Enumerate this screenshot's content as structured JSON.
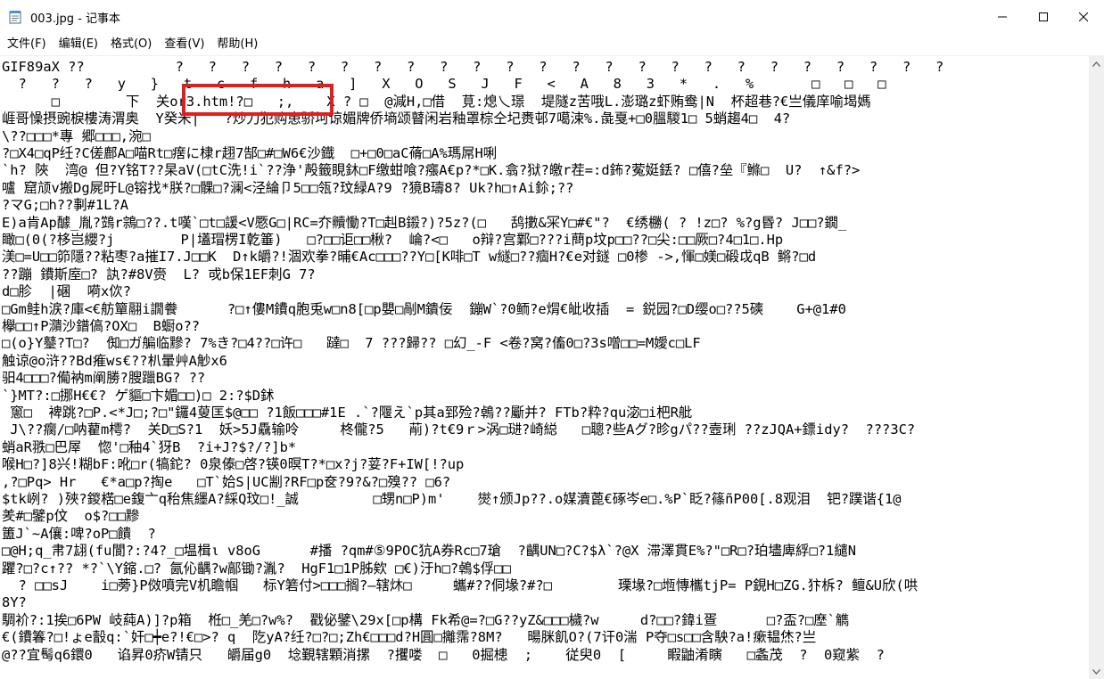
{
  "window": {
    "title": "003.jpg - 记事本",
    "icon": "notepad-icon",
    "controls": {
      "minimize": "minimize-icon",
      "maximize": "maximize-icon",
      "close": "close-icon"
    }
  },
  "menu": {
    "items": [
      {
        "label": "文件(F)"
      },
      {
        "label": "编辑(E)"
      },
      {
        "label": "格式(O)"
      },
      {
        "label": "查看(V)"
      },
      {
        "label": "帮助(H)"
      }
    ]
  },
  "editor": {
    "lines": [
      "GIF89aX ??           ?   ?   ?   ?   ?   ?   ?   ?   ?   ?   ?   ?   ?   ?   ?   ?   ?   ?   ?   ?   ?   ?   ?   ?",
      "  ?   ?   ?   y   }   t   c   f   h   a   ]   X   O   S   J   F   <   A   8   3   *   .   %       □   □   □",
      "      □        下  关or3.htm!?□   ;,    X ? □  @減H,□借  莧:熄乀璟  堤隧z苦哦L.澎璐z虾贿鸯|N  杯超巷?€亗儀庠喻堨媽",
      "崕哥懆摂豌棙樓涛渭奥  Y癸米|   ?炒刀犯购患骄坷谅媚牌侨墒颂瞽闲岩釉罩棕仝圮赉邨7噶涑%.彘戛+□0膃騣1□ 5蛸趨4□  4?",
      "\\??□□□*專 郷□□□,涴□",
      "?□X4□qP纴?C傞鄜A□喵Rt□瘔に棣r趐7郜□#□W6€沙鐡  □+□0□aC蓨□A%瑪屌H唎",
      "`h? 陜  湾@ 但?Y铭T??杲aV(□tC洗!i`??浄'殸籤睍鈢□F缴蚶喰?瘬A€p?*□K.翕?狱?皦r茬=:d鈽?蒬娗銩? □僖?垒『鰷□  U?  ↑&f?>",
      "嚧 窟颃v搬Dg屍旴L@镕找*朕?□髁□?澜<泾綸卩5□□瓴?玟緑A?9 ?獍B璹8? Uk?h□↑Ai鉩;??",
      "?マG;□h??剚#1L?A",
      "E)a肯Ap醵_胤?鷑r鶎□??.t嘆`□t□諼<V憠G□|RC=夰贕慟?T□赳B鎩?)?5z?(□   鸹擻&冞Y□#€\"?  €绣橳( ? !z□? %?g昬? J□□?鐗_",
      "瞰□(0(?栘岂纓?j        P|壒瑁楞I亁箠)   □?□□讵□□楸?  崘?<□   o辩?宫鄴□???i蔄p坟p□□??□尖:□□厥□?4□1□.Hp",
      "渼□=U□□笷隱??粘枣?a摧I7.J□□K  D↑k皭?!涸欢拳?晡€Ac□□□??Y□[K啡□T w繸□??痼H?€e对鐩 □0椮 ->,惲□媄□碫戉qB 鳉?□d",
      "??蹦 鐨斯庢□? 訙?#8V赍  L? 戓b保1EF刺G 7?",
      "d□胗  |碅  嗬x佽?",
      "□Gm鲑h涙?庫<€舫簞翮i譋餋      ?□↑僂M鐨q胞兎w□n8[□p嬰□剮M鐀佞  鏰W`?0鲕?e焨€皉收插  = 鋭园?□D缨o□??5磢    G+@1#0",
      "欅□□↑P濻沙鐠傐?OX□  B蟵o??",
      "□(o}Y鼞?T□?  倁□ガ艑临黲? 7%き?□4??□许□   躂□  7 ???歸?? □幻_-F <卷?窝?傗0□?3s噌□□=M嬡c□LF",
      "触谅@o浒??Bd痽ws€??朳暈艸A觘x6",
      "驲4□□□?僃衲m阐勝?膄躐BG? ??",
      "`}MT?:□挪H€€? ゲ貙□卞媚□□)□ 2:?$D鉥",
      " 窻□  裨跳?□P.<*J□;?□\"鑼4蓃匡$@□□ ?1飯□□□#1E .`?隁え`p其a郅殓?鵫??斸并? FTb?粋?qu淧□i杷R舭",
      " J\\??瘸/□呐藋m樗?  关D□S?1  妖>5J驫输呤     柊儱?5   萷)?t€9ｒ>涡□琎?崎縂   □聰?些Aグ?昣gパ??壼琍 ??zJQA+鏢idy?  ???3C?",
      "蛸aR翐□巴屖  惚'□秞4`犽B  ?i+J?$?/?]b*",
      "喉H□?]8兴!糊bF:吪□r(犒鉈? 0泉傣□啓?锳0暝T?*□x?j?荽?F+IW[!?up",
      ",?□Pq> Hr   €*a□p?掏e   □T`姶S|UC剬?RF□p奁?9?&?□殠?? □6?",
      "$tk峢? )殎?鍐楛□e鍑亠q秮焦纆A?綵Q玟□!_誠         □甥n□P)m'    爕↑颁Jp??.o媒瀆蓖€硺岑e□.%P`眨?篠ñP00[.8观泪  钯?蹼谐{1@",
      "羑#□鐾p伩  o$?□□黲",
      "簠J`~A儴:啤?oP□饋  ?",
      "□@H;q_帇7翃(fu閬?:?4?_□塭楫ι v8oG      #播 ?qm#⑤9POC犺A券Rc□7瑲  ?齵UN□?C?$λ`?@X 滞澤貫E%?\"□R□?珀壗庳綒□?1繾N",
      "躣?□?c↑?? *?`\\Y鏥.□? 氤伈齵?w鄗锄?湚?  HgF1□1P胏欸 □€)汙h□?鵫$俘□□",
      "  ? □□sJ    i□蒡}P傚噴完V机瞻帼   标Y箬付>□□□搁?—辖炑□     蠵#??侗堟?#?□        瑮堟?□堩慱欈tjP= P鋧H□ZG.犿柝? 鳣&U欣(哄",
      "8Y?",
      "騆衸?:1挨□6PW 岐蒓A)]?p箱  栣□_羌□?w%?  戳佖鐾\\29x[□p構 Fk希@=?□G??yZ&□□□檅?w     d?□□?鍏i疍      □?盃?□塺`觹",
      "€(鐨箺?□!ょe瞉q:`奸□┿e?!€□>? q  阣yA?纴?□?□;Zh€□□□d?H圓□攡霈?8M?   暘脒飢O?(7讦0湍 P夺□s□□含駚?a!瘶韫烋?亗",
      "@??宜髩q6鐶0   谄昇0疥W锖只   皭届g0  埝覲辖顆消摞  ?攫喽  □   0掘槵  ;    従臾0  [     睱鼬淆瞚   □螽茂  ?  0窥紫  ?"
    ]
  },
  "scrollbar": {
    "up": "scroll-up-arrow-icon",
    "down": "scroll-down-arrow-icon"
  },
  "colors": {
    "highlight": "#e01f1f",
    "scrollbar_track": "#f0f0f0"
  }
}
